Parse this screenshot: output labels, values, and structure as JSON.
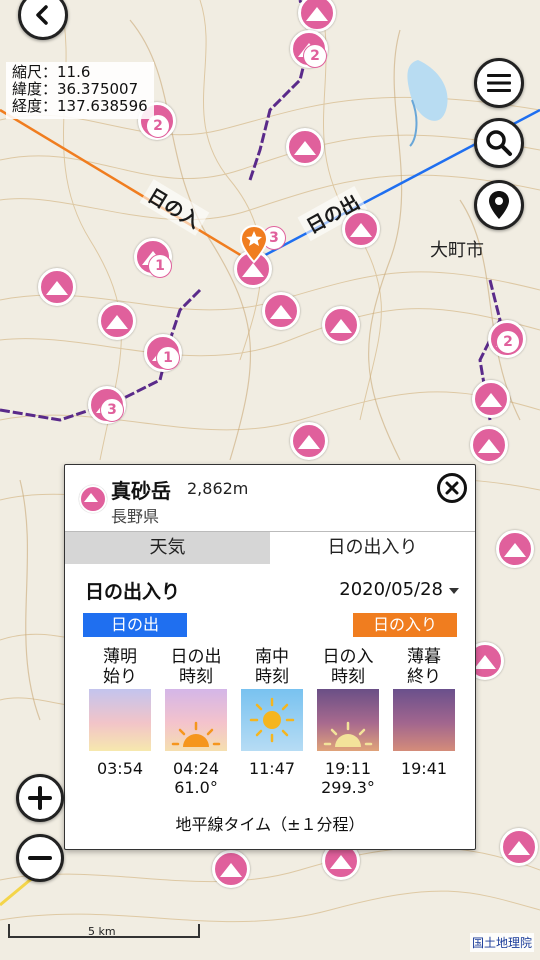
{
  "map": {
    "scale_label": "縮尺：",
    "scale_value": "11.6",
    "lat_label": "緯度：",
    "lat_value": "36.375007",
    "lon_label": "経度：",
    "lon_value": "137.638596",
    "sunset_line_label": "日の入",
    "sunrise_line_label": "日の出",
    "town_label": "大町市",
    "scale_bar_label": "5 km",
    "attribution": "国土地理院",
    "peak_badges": [
      "2",
      "2",
      "1",
      "3",
      "1",
      "3",
      "2"
    ]
  },
  "controls": {
    "back_icon": "chevron-left-icon",
    "menu_icon": "hamburger-menu-icon",
    "search_icon": "search-icon",
    "location_icon": "location-pin-icon",
    "zoom_in_icon": "plus-icon",
    "zoom_out_icon": "minus-icon"
  },
  "popup": {
    "name": "真砂岳",
    "elevation": "2,862m",
    "prefecture": "長野県",
    "tabs": [
      {
        "label": "天気",
        "active": false
      },
      {
        "label": "日の出入り",
        "active": true
      }
    ],
    "section_title": "日の出入り",
    "date": "2020/05/28",
    "sunrise_badge": "日の出",
    "sunset_badge": "日の入り",
    "phases": [
      {
        "label": "薄明\n始り",
        "time": "03:54",
        "azimuth": ""
      },
      {
        "label": "日の出\n時刻",
        "time": "04:24",
        "azimuth": "61.0°"
      },
      {
        "label": "南中\n時刻",
        "time": "11:47",
        "azimuth": ""
      },
      {
        "label": "日の入\n時刻",
        "time": "19:11",
        "azimuth": "299.3°"
      },
      {
        "label": "薄暮\n終り",
        "time": "19:41",
        "azimuth": ""
      }
    ],
    "footer": "地平線タイム（±１分程）",
    "colors": {
      "sunrise": "#1f6ff0",
      "sunset": "#f07d1f",
      "peak": "#e0609c"
    }
  }
}
